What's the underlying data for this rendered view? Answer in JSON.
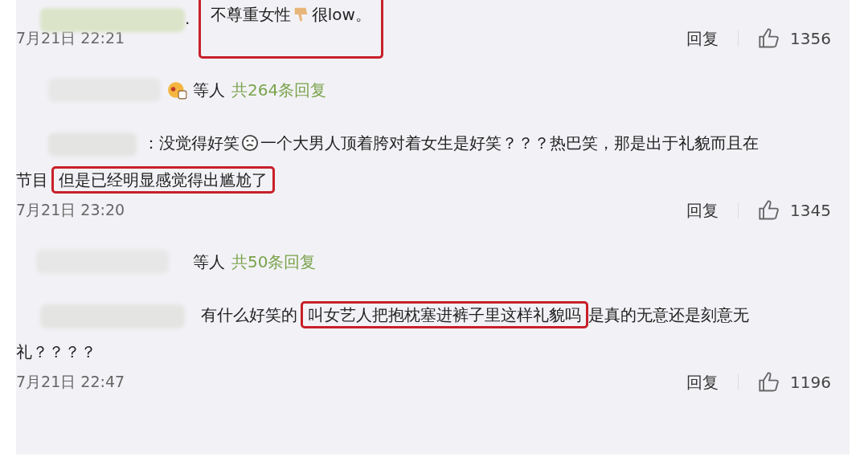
{
  "comments": [
    {
      "segments": [
        {
          "kind": "text",
          "text": ". "
        },
        {
          "kind": "highlight",
          "parts": [
            {
              "kind": "text",
              "text": "不尊重女性"
            },
            {
              "kind": "thumbs-down"
            },
            {
              "kind": "text",
              "text": "很low。"
            }
          ]
        }
      ],
      "date": "7月21日 22:21",
      "reply": "回复",
      "likes": "1356",
      "summary": {
        "group_icon": true,
        "label": "等人",
        "count": "共264条回复"
      }
    },
    {
      "segments": [
        {
          "kind": "text",
          "text": "：没觉得好笑"
        },
        {
          "kind": "face"
        },
        {
          "kind": "text",
          "text": "一个大男人顶着胯对着女生是好笑？？？热巴笑，那是出于礼貌而且在"
        },
        {
          "kind": "break"
        },
        {
          "kind": "text",
          "text": "节目"
        },
        {
          "kind": "highlight",
          "parts": [
            {
              "kind": "text",
              "text": "但是已经明显感觉得出尴尬了"
            }
          ]
        }
      ],
      "date": "7月21日 23:20",
      "reply": "回复",
      "likes": "1345",
      "summary": {
        "group_icon": false,
        "label": "等人",
        "count": "共50条回复"
      }
    },
    {
      "segments": [
        {
          "kind": "text",
          "text": "有什么好笑的"
        },
        {
          "kind": "highlight",
          "parts": [
            {
              "kind": "text",
              "text": "叫女艺人把抱枕塞进裤子里这样礼貌吗"
            }
          ]
        },
        {
          "kind": "text",
          "text": "是真的无意还是刻意无"
        },
        {
          "kind": "break"
        },
        {
          "kind": "text",
          "text": "礼？？？？"
        }
      ],
      "date": "7月21日 22:47",
      "reply": "回复",
      "likes": "1196"
    }
  ]
}
